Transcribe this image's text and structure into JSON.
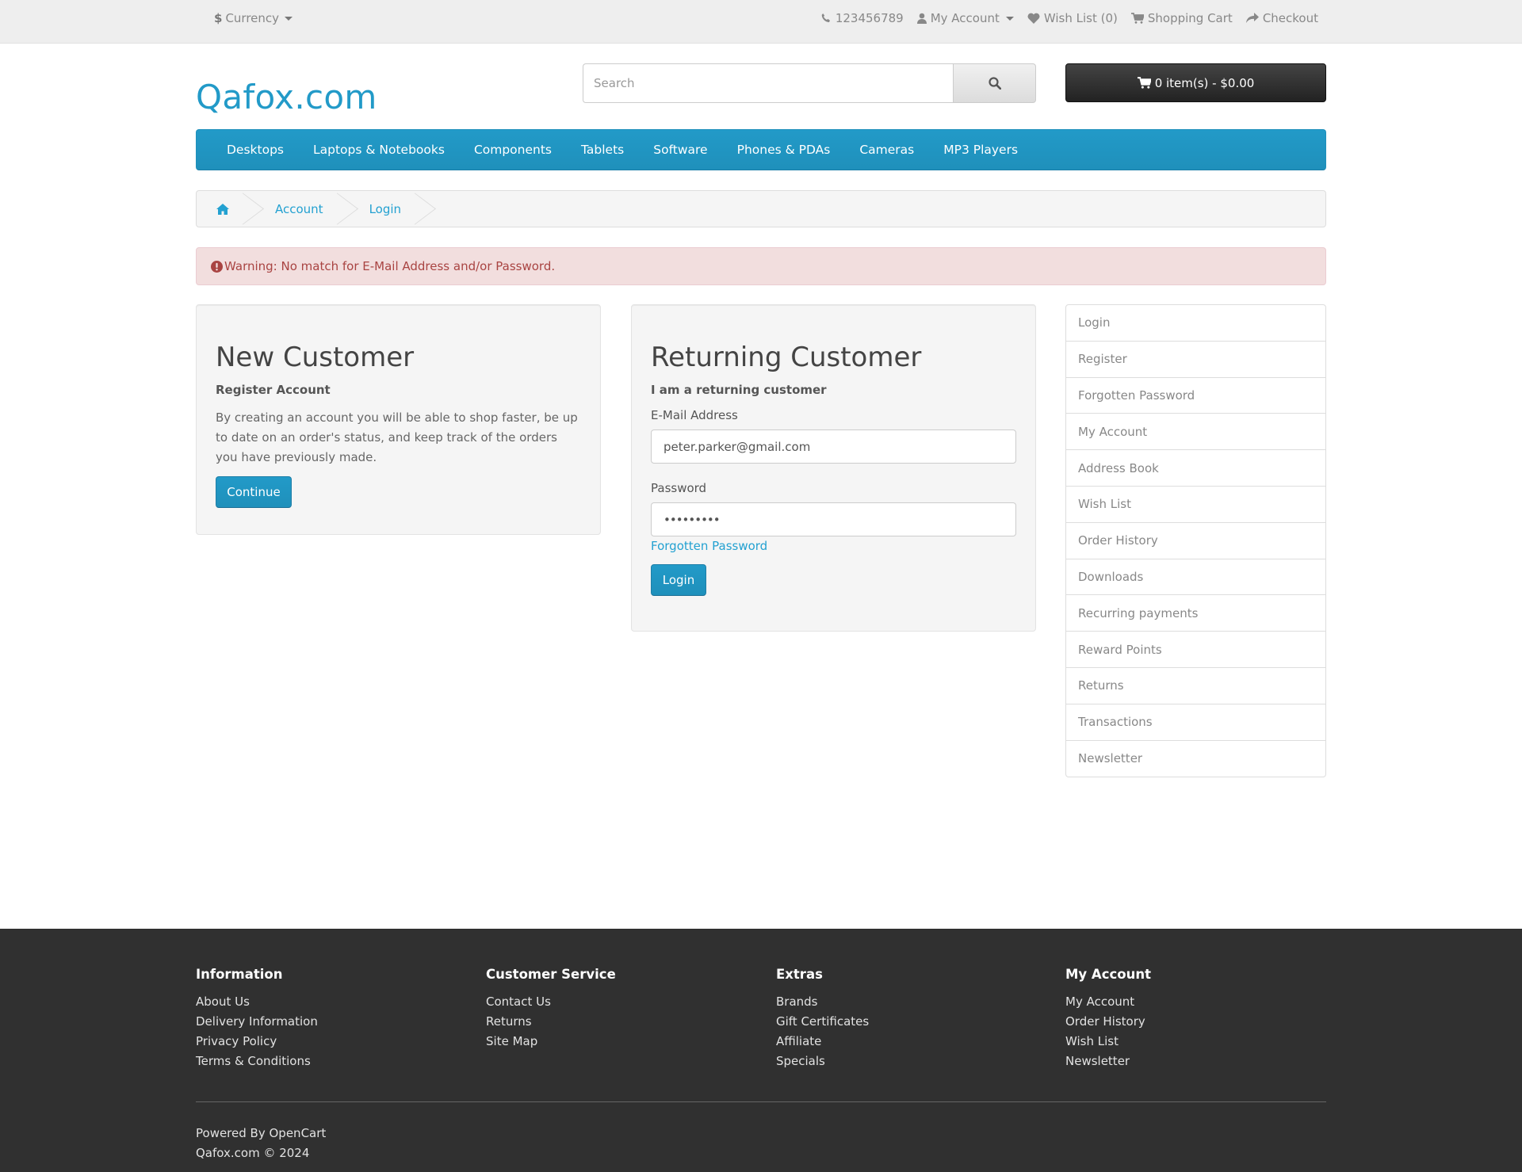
{
  "topbar": {
    "currency_symbol": "$",
    "currency_label": "Currency",
    "phone": "123456789",
    "my_account": "My Account",
    "wishlist": "Wish List (0)",
    "shopping_cart": "Shopping Cart",
    "checkout": "Checkout"
  },
  "header": {
    "logo": "Qafox.com",
    "search_placeholder": "Search",
    "cart_button": "0 item(s) - $0.00"
  },
  "menu": {
    "items": [
      "Desktops",
      "Laptops & Notebooks",
      "Components",
      "Tablets",
      "Software",
      "Phones & PDAs",
      "Cameras",
      "MP3 Players"
    ]
  },
  "breadcrumb": {
    "items": [
      "Account",
      "Login"
    ]
  },
  "alert": {
    "text": "Warning: No match for E-Mail Address and/or Password."
  },
  "new_customer": {
    "title": "New Customer",
    "subtitle": "Register Account",
    "description": "By creating an account you will be able to shop faster, be up to date on an order's status, and keep track of the orders you have previously made.",
    "button": "Continue"
  },
  "returning_customer": {
    "title": "Returning Customer",
    "subtitle": "I am a returning customer",
    "email_label": "E-Mail Address",
    "email_value": "peter.parker@gmail.com",
    "password_label": "Password",
    "password_value": "•••••••••",
    "forgotten_link": "Forgotten Password",
    "button": "Login"
  },
  "sidebar": {
    "items": [
      "Login",
      "Register",
      "Forgotten Password",
      "My Account",
      "Address Book",
      "Wish List",
      "Order History",
      "Downloads",
      "Recurring payments",
      "Reward Points",
      "Returns",
      "Transactions",
      "Newsletter"
    ]
  },
  "footer": {
    "information": {
      "title": "Information",
      "links": [
        "About Us",
        "Delivery Information",
        "Privacy Policy",
        "Terms & Conditions"
      ]
    },
    "customer_service": {
      "title": "Customer Service",
      "links": [
        "Contact Us",
        "Returns",
        "Site Map"
      ]
    },
    "extras": {
      "title": "Extras",
      "links": [
        "Brands",
        "Gift Certificates",
        "Affiliate",
        "Specials"
      ]
    },
    "my_account": {
      "title": "My Account",
      "links": [
        "My Account",
        "Order History",
        "Wish List",
        "Newsletter"
      ]
    },
    "powered_by": "Powered By",
    "opencart": "OpenCart",
    "copyright": "Qafox.com © 2024"
  },
  "colors": {
    "accent": "#229ac8",
    "alert_bg": "#f2dede",
    "alert_text": "#a94442",
    "footer_bg": "#303030"
  }
}
